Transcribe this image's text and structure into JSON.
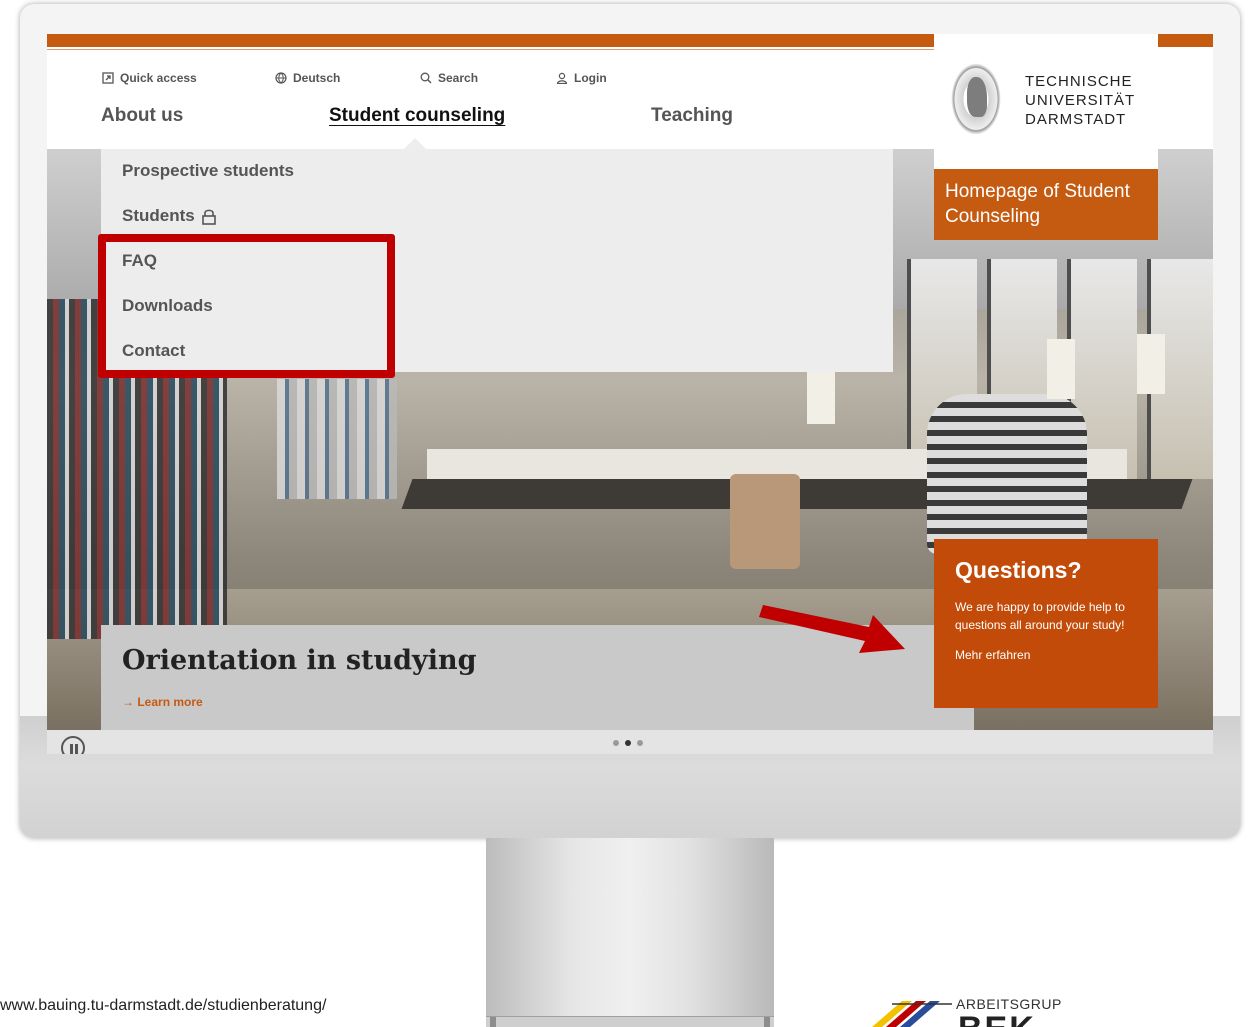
{
  "utility_nav": {
    "quick_access": "Quick access",
    "language": "Deutsch",
    "search": "Search",
    "login": "Login"
  },
  "main_nav": {
    "about": "About us",
    "counseling": "Student counseling",
    "teaching": "Teaching"
  },
  "logo": {
    "line1": "TECHNISCHE",
    "line2": "UNIVERSITÄT",
    "line3": "DARMSTADT"
  },
  "homepage_box": "Homepage of Student Counseling",
  "dropdown": {
    "items": [
      "Prospective students",
      "Students",
      "FAQ",
      "Downloads",
      "Contact"
    ]
  },
  "hero": {
    "title": "Orientation in studying",
    "link": "Learn more"
  },
  "questions": {
    "title": "Questions?",
    "body": "We are happy to provide help to questions all around your study!",
    "link": "Mehr erfahren"
  },
  "footer": {
    "url": "www.bauing.tu-darmstadt.de/studienberatung/",
    "logo_text": "ARBEITSGRUPPE",
    "logo_big": "BEK"
  },
  "colors": {
    "accent": "#c55a11",
    "questions_bg": "#c24b0a",
    "annotation": "#c00000"
  }
}
